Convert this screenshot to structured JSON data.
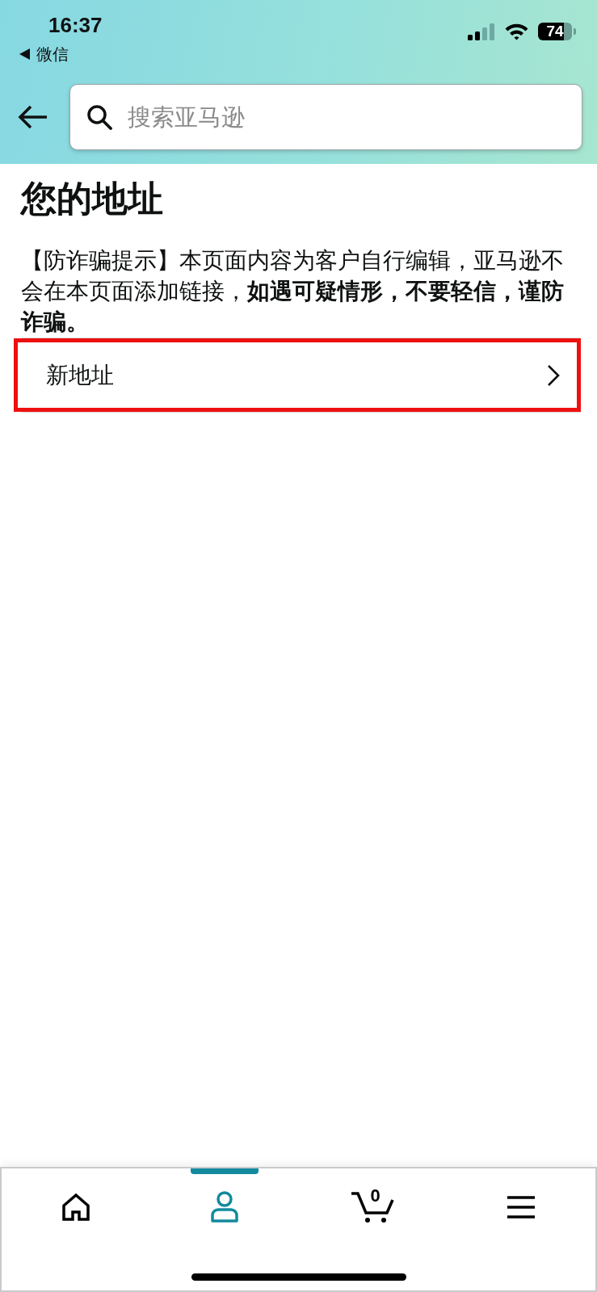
{
  "status_bar": {
    "time": "16:37",
    "back_app": "微信",
    "battery": "74"
  },
  "header": {
    "search": {
      "placeholder": "搜索亚马逊"
    }
  },
  "page": {
    "title": "您的地址",
    "notice": "【防诈骗提示】本页面内容为客户自行编辑，亚马逊不会在本页面添加链接，**如遇可疑情形，不要轻信，谨防诈骗。**",
    "items": [
      {
        "label": "新地址",
        "highlighted": true
      }
    ]
  },
  "tab_bar": {
    "tabs": [
      {
        "kind": "home",
        "selected": false
      },
      {
        "kind": "account",
        "selected": true
      },
      {
        "kind": "cart",
        "selected": false,
        "count": "0"
      },
      {
        "kind": "menu",
        "selected": false
      }
    ]
  }
}
